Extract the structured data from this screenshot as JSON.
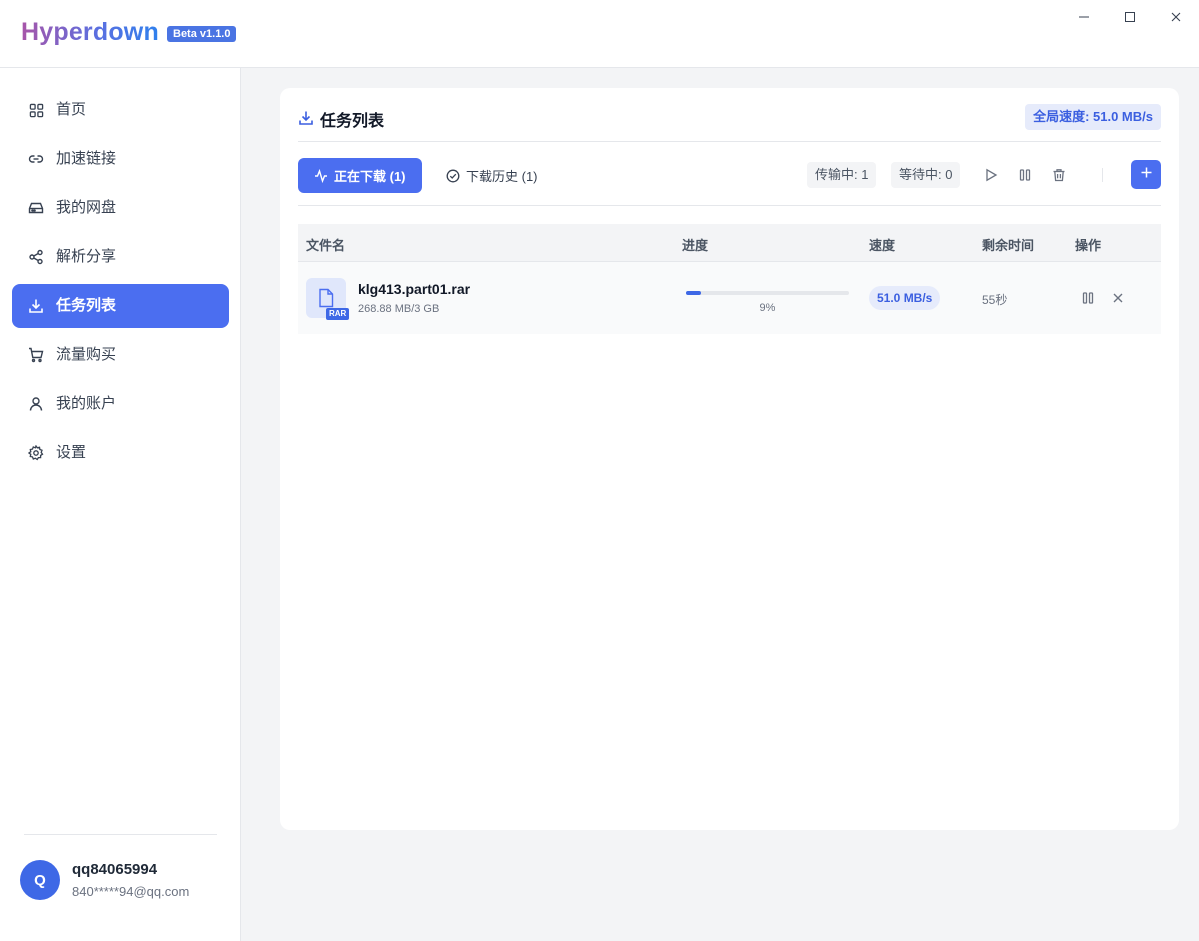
{
  "app": {
    "name": "Hyperdown",
    "badge": "Beta v1.1.0"
  },
  "window_controls": [
    "minimize-icon",
    "maximize-icon",
    "close-icon"
  ],
  "sidebar": {
    "items": [
      {
        "label": "首页",
        "icon": "grid-icon",
        "active": false
      },
      {
        "label": "加速链接",
        "icon": "link-icon",
        "active": false
      },
      {
        "label": "我的网盘",
        "icon": "drive-icon",
        "active": false
      },
      {
        "label": "解析分享",
        "icon": "share-icon",
        "active": false
      },
      {
        "label": "任务列表",
        "icon": "download-icon",
        "active": true
      },
      {
        "label": "流量购买",
        "icon": "cart-icon",
        "active": false
      },
      {
        "label": "我的账户",
        "icon": "user-icon",
        "active": false
      },
      {
        "label": "设置",
        "icon": "gear-icon",
        "active": false
      }
    ],
    "user": {
      "initial": "Q",
      "name": "qq84065994",
      "email": "840*****94@qq.com"
    }
  },
  "main": {
    "title": "任务列表",
    "global_speed": "全局速度: 51.0 MB/s",
    "tabs": [
      {
        "label": "正在下载 (1)",
        "active": true
      },
      {
        "label": "下载历史 (1)",
        "active": false
      }
    ],
    "stats": {
      "transferring": "传输中: 1",
      "waiting": "等待中: 0"
    },
    "table": {
      "columns": [
        "文件名",
        "进度",
        "速度",
        "剩余时间",
        "操作"
      ],
      "rows": [
        {
          "file_name": "klg413.part01.rar",
          "ext": "RAR",
          "size": "268.88 MB/3 GB",
          "progress": 0.09,
          "progress_text": "9%",
          "speed": "51.0 MB/s",
          "remaining": "55秒"
        }
      ]
    }
  },
  "colors": {
    "accent": "#4b6ef0",
    "accent_light": "#e6ebfb",
    "brand_gradient_start": "#a855a8",
    "brand_gradient_end": "#2f80ed"
  }
}
